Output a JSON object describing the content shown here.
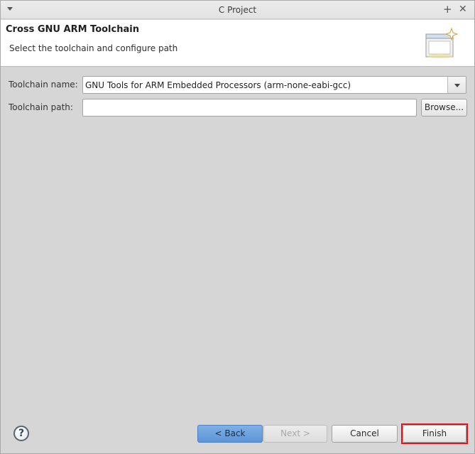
{
  "window": {
    "title": "C Project"
  },
  "header": {
    "heading": "Cross GNU ARM Toolchain",
    "description": "Select the toolchain and configure path",
    "icon": "wizard-banner-icon"
  },
  "form": {
    "toolchain_name_label": "Toolchain name:",
    "toolchain_name_value": "GNU Tools for ARM Embedded Processors (arm-none-eabi-gcc)",
    "toolchain_path_label": "Toolchain path:",
    "toolchain_path_value": "",
    "browse_label": "Browse..."
  },
  "footer": {
    "help_glyph": "?",
    "back_label": "< Back",
    "next_label": "Next >",
    "cancel_label": "Cancel",
    "finish_label": "Finish",
    "highlight_color": "#e0141e"
  }
}
